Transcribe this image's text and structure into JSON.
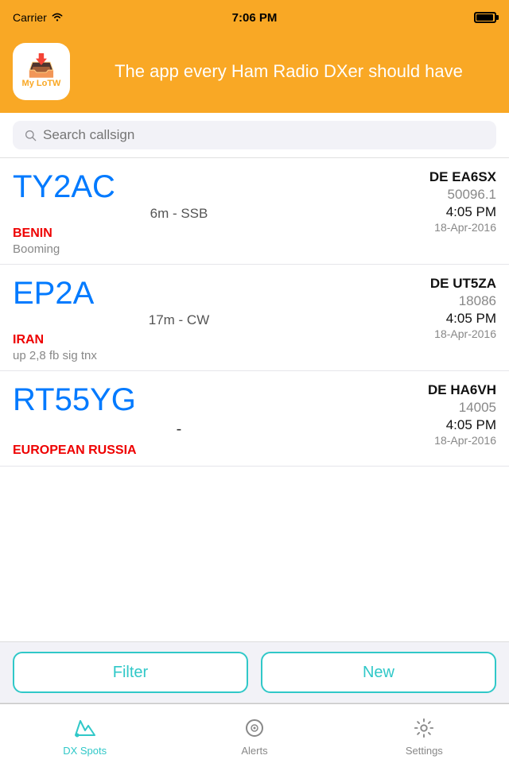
{
  "statusBar": {
    "carrier": "Carrier",
    "time": "7:06 PM",
    "battery": "full"
  },
  "header": {
    "logoText": "My LoTW",
    "tagline": "The app every Ham Radio DXer should have"
  },
  "search": {
    "placeholder": "Search callsign"
  },
  "spots": [
    {
      "callsign": "TY2AC",
      "mode": "6m - SSB",
      "country": "BENIN",
      "comment": "Booming",
      "de": "DE EA6SX",
      "freq": "50096.1",
      "time": "4:05 PM",
      "date": "18-Apr-2016",
      "separator": ""
    },
    {
      "callsign": "EP2A",
      "mode": "17m - CW",
      "country": "IRAN",
      "comment": "up 2,8 fb sig tnx",
      "de": "DE UT5ZA",
      "freq": "18086",
      "time": "4:05 PM",
      "date": "18-Apr-2016",
      "separator": ""
    },
    {
      "callsign": "RT55YG",
      "mode": "-",
      "country": "EUROPEAN RUSSIA",
      "comment": "",
      "de": "DE HA6VH",
      "freq": "14005",
      "time": "4:05 PM",
      "date": "18-Apr-2016",
      "separator": "-"
    }
  ],
  "buttons": {
    "filter": "Filter",
    "new": "New"
  },
  "tabs": [
    {
      "id": "dx-spots",
      "label": "DX Spots",
      "icon": "📢",
      "active": true
    },
    {
      "id": "alerts",
      "label": "Alerts",
      "icon": "⊙",
      "active": false
    },
    {
      "id": "settings",
      "label": "Settings",
      "icon": "⚙",
      "active": false
    }
  ]
}
